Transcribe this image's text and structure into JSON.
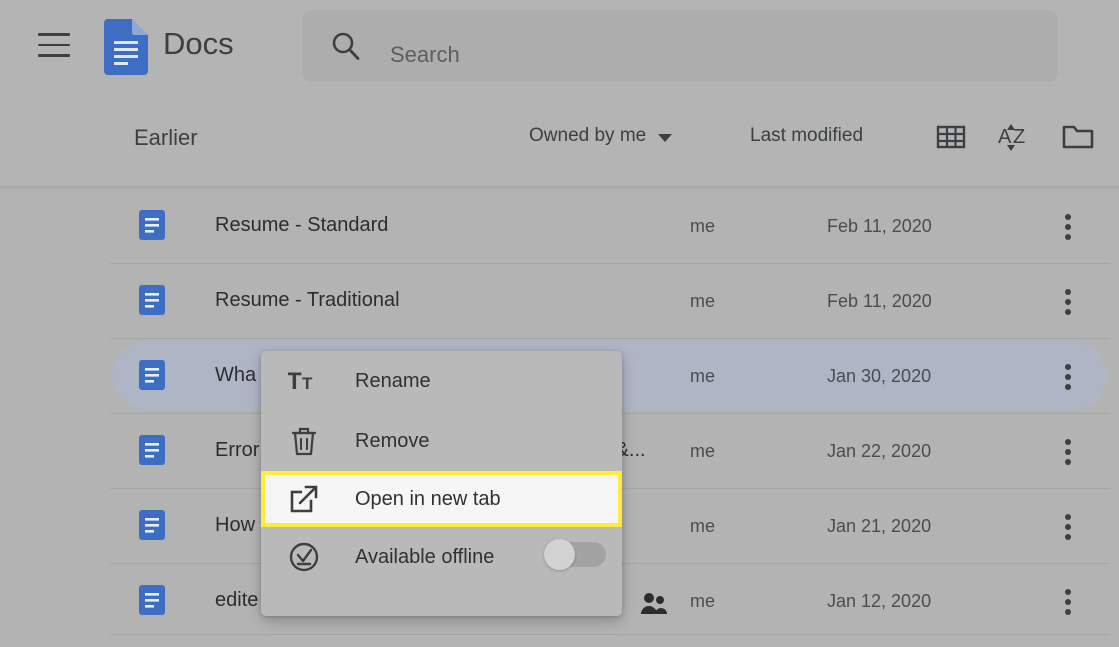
{
  "app": {
    "brand": "Docs",
    "menu_icon": "hamburger-icon",
    "logo_icon": "google-docs-logo"
  },
  "search": {
    "placeholder": "Search",
    "value": "",
    "icon": "search-icon"
  },
  "toolbar": {
    "section_title": "Earlier",
    "owner_filter": "Owned by me",
    "owner_filter_caret": "chevron-down-icon",
    "sort_label": "Last modified",
    "grid_view_icon": "grid-view-icon",
    "sort_az_icon": "sort-az-icon",
    "folder_icon": "folder-icon"
  },
  "list": {
    "columns": [
      "title",
      "shared",
      "owner",
      "modified",
      "actions"
    ],
    "rows": [
      {
        "title": "Resume - Standard",
        "owner": "me",
        "modified": "Feb 11, 2020",
        "shared": false,
        "selected": false
      },
      {
        "title": "Resume - Traditional",
        "owner": "me",
        "modified": "Feb 11, 2020",
        "shared": false,
        "selected": false
      },
      {
        "title": "Wha",
        "owner": "me",
        "modified": "Jan 30, 2020",
        "shared": false,
        "selected": true
      },
      {
        "title": "Error",
        "owner": "me",
        "modified": "Jan 22, 2020",
        "shared": false,
        "selected": false,
        "title_tail": "s &..."
      },
      {
        "title": "How",
        "owner": "me",
        "modified": "Jan 21, 2020",
        "shared": false,
        "selected": false
      },
      {
        "title": "edite",
        "owner": "me",
        "modified": "Jan 12, 2020",
        "shared": true,
        "selected": false
      }
    ]
  },
  "context_menu": {
    "items": [
      {
        "label": "Rename",
        "icon": "text-format-icon",
        "highlighted": false
      },
      {
        "label": "Remove",
        "icon": "trash-icon",
        "highlighted": false
      },
      {
        "label": "Open in new tab",
        "icon": "open-new-tab-icon",
        "highlighted": true
      },
      {
        "label": "Available offline",
        "icon": "offline-check-icon",
        "highlighted": false,
        "toggle": "off"
      }
    ]
  },
  "colors": {
    "highlight_outline": "#ffeb3b",
    "docs_blue": "#3d6ec4",
    "selected_row": "#aeb5c4",
    "page_bg": "#b3b3b3",
    "menu_bg": "#b9b9b9"
  }
}
